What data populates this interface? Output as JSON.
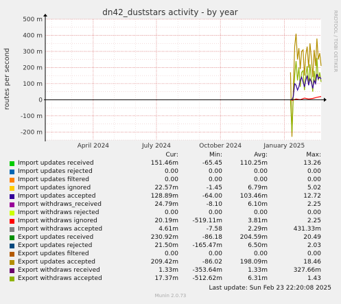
{
  "title": "dn42_duststars activity - by year",
  "watermark": "RRDTOOL / TOBI OETIKER",
  "footer": "Munin 2.0.73",
  "last_update": "Last update: Sun Feb 23 22:20:08 2025",
  "columns": [
    "Cur:",
    "Min:",
    "Avg:",
    "Max:"
  ],
  "legend": [
    {
      "name": "Import updates received",
      "color": "#00cc00",
      "cur": "151.46m",
      "min": "-65.45",
      "avg": "110.25m",
      "max": "13.26"
    },
    {
      "name": "Import updates rejected",
      "color": "#0066b3",
      "cur": "0.00",
      "min": "0.00",
      "avg": "0.00",
      "max": "0.00"
    },
    {
      "name": "Import updates filtered",
      "color": "#ff8000",
      "cur": "0.00",
      "min": "0.00",
      "avg": "0.00",
      "max": "0.00"
    },
    {
      "name": "Import updates ignored",
      "color": "#ffcc00",
      "cur": "22.57m",
      "min": "-1.45",
      "avg": "6.79m",
      "max": "5.02"
    },
    {
      "name": "Import updates accepted",
      "color": "#330099",
      "cur": "128.89m",
      "min": "-64.00",
      "avg": "103.46m",
      "max": "12.72"
    },
    {
      "name": "Import withdraws_received",
      "color": "#990099",
      "cur": "24.79m",
      "min": "-8.10",
      "avg": "6.10m",
      "max": "2.25"
    },
    {
      "name": "Import withdraws rejected",
      "color": "#ccff00",
      "cur": "0.00",
      "min": "0.00",
      "avg": "0.00",
      "max": "0.00"
    },
    {
      "name": "Import withdraws ignored",
      "color": "#ff0000",
      "cur": "20.19m",
      "min": "-519.11m",
      "avg": "3.81m",
      "max": "2.25"
    },
    {
      "name": "Import withdraws accepted",
      "color": "#808080",
      "cur": "4.61m",
      "min": "-7.58",
      "avg": "2.29m",
      "max": "431.33m"
    },
    {
      "name": "Export updates received",
      "color": "#008f00",
      "cur": "230.92m",
      "min": "-86.18",
      "avg": "204.59m",
      "max": "20.49"
    },
    {
      "name": "Export updates rejected",
      "color": "#00487d",
      "cur": "21.50m",
      "min": "-165.47m",
      "avg": "6.50m",
      "max": "2.03"
    },
    {
      "name": "Export updates filtered",
      "color": "#b35a00",
      "cur": "0.00",
      "min": "0.00",
      "avg": "0.00",
      "max": "0.00"
    },
    {
      "name": "Export updates accepted",
      "color": "#b38f00",
      "cur": "209.42m",
      "min": "-86.02",
      "avg": "198.09m",
      "max": "18.46"
    },
    {
      "name": "Export withdraws received",
      "color": "#6b006b",
      "cur": "1.33m",
      "min": "-353.64m",
      "avg": "1.33m",
      "max": "327.66m"
    },
    {
      "name": "Export withdraws accepted",
      "color": "#8fb300",
      "cur": "17.37m",
      "min": "-512.62m",
      "avg": "6.31m",
      "max": "1.43"
    }
  ],
  "chart_data": {
    "type": "line",
    "title": "dn42_duststars activity - by year",
    "ylabel": "routes per second",
    "xlabel": "",
    "ylim": [
      -250,
      500
    ],
    "yticks": [
      500,
      400,
      300,
      200,
      100,
      0,
      -100,
      -200
    ],
    "ytick_labels": [
      "500 m",
      "400 m",
      "300 m",
      "200 m",
      "100 m",
      "0",
      "-100 m",
      "-200 m"
    ],
    "xrange": [
      "2024-01-23",
      "2025-02-23"
    ],
    "xticks": [
      {
        "date": "2024-04-01",
        "label": "April 2024"
      },
      {
        "date": "2024-07-01",
        "label": "July 2024"
      },
      {
        "date": "2024-10-01",
        "label": "October 2024"
      },
      {
        "date": "2025-01-01",
        "label": "January 2025"
      }
    ],
    "grid": true,
    "series": [
      {
        "name": "Export updates accepted",
        "color": "#b38f00",
        "x": [
          "2025-01-10",
          "2025-01-12",
          "2025-01-14",
          "2025-01-16",
          "2025-01-18",
          "2025-01-20",
          "2025-01-22",
          "2025-01-24",
          "2025-01-26",
          "2025-01-28",
          "2025-01-30",
          "2025-02-01",
          "2025-02-03",
          "2025-02-05",
          "2025-02-07",
          "2025-02-09",
          "2025-02-11",
          "2025-02-13",
          "2025-02-15",
          "2025-02-17",
          "2025-02-19",
          "2025-02-21",
          "2025-02-23"
        ],
        "y": [
          170,
          -230,
          60,
          330,
          410,
          250,
          320,
          190,
          300,
          310,
          150,
          280,
          330,
          200,
          350,
          260,
          140,
          310,
          210,
          380,
          250,
          290,
          210
        ]
      },
      {
        "name": "Export withdraws accepted",
        "color": "#8fb300",
        "x": [
          "2025-01-10",
          "2025-01-12",
          "2025-01-14",
          "2025-01-16",
          "2025-01-18",
          "2025-01-20",
          "2025-01-22",
          "2025-01-24",
          "2025-01-26",
          "2025-01-28",
          "2025-01-30",
          "2025-02-01",
          "2025-02-03",
          "2025-02-05",
          "2025-02-07",
          "2025-02-09",
          "2025-02-11",
          "2025-02-13",
          "2025-02-15",
          "2025-02-17",
          "2025-02-19",
          "2025-02-21",
          "2025-02-23"
        ],
        "y": [
          0,
          -200,
          20,
          150,
          240,
          120,
          200,
          80,
          170,
          180,
          60,
          150,
          210,
          90,
          220,
          130,
          50,
          180,
          100,
          260,
          120,
          170,
          110
        ]
      },
      {
        "name": "Import updates accepted",
        "color": "#330099",
        "x": [
          "2025-01-10",
          "2025-01-12",
          "2025-01-14",
          "2025-01-16",
          "2025-01-18",
          "2025-01-20",
          "2025-01-22",
          "2025-01-24",
          "2025-01-26",
          "2025-01-28",
          "2025-01-30",
          "2025-02-01",
          "2025-02-03",
          "2025-02-05",
          "2025-02-07",
          "2025-02-09",
          "2025-02-11",
          "2025-02-13",
          "2025-02-15",
          "2025-02-17",
          "2025-02-19",
          "2025-02-21",
          "2025-02-23"
        ],
        "y": [
          0,
          0,
          20,
          100,
          90,
          60,
          80,
          120,
          140,
          110,
          80,
          120,
          150,
          90,
          130,
          110,
          70,
          120,
          100,
          160,
          130,
          140,
          129
        ]
      },
      {
        "name": "Import withdraws ignored",
        "color": "#ff0000",
        "x": [
          "2025-01-12",
          "2025-01-18",
          "2025-01-24",
          "2025-01-30",
          "2025-02-05",
          "2025-02-11",
          "2025-02-17",
          "2025-02-23"
        ],
        "y": [
          -5,
          5,
          0,
          10,
          5,
          8,
          15,
          20
        ]
      }
    ]
  }
}
